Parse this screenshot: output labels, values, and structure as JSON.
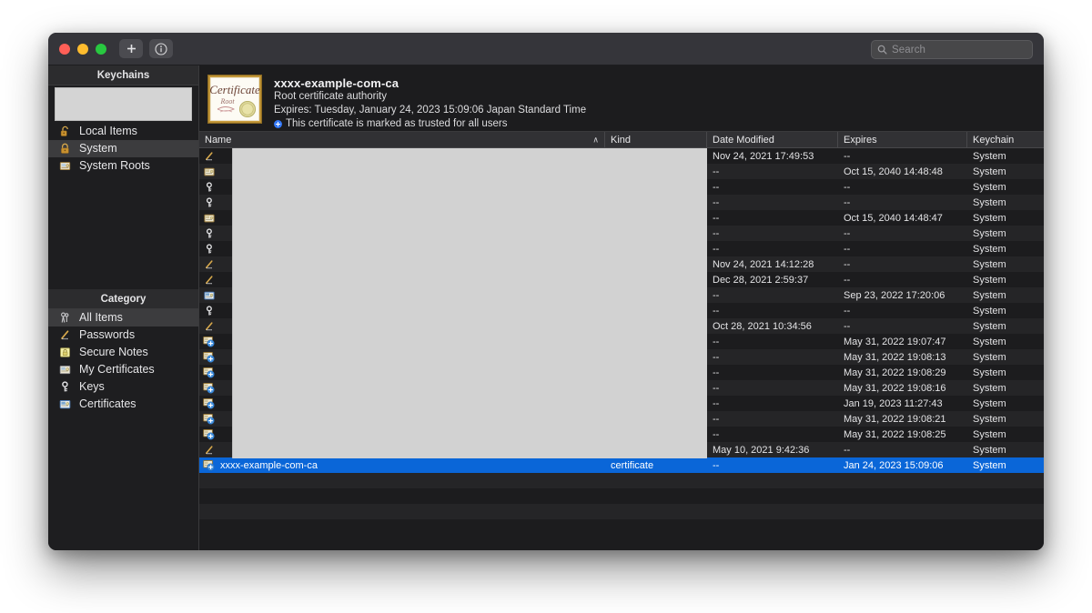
{
  "window": {
    "traffic_lights": [
      "close",
      "minimize",
      "maximize"
    ],
    "colors": {
      "close": "#ff5f57",
      "minimize": "#febc2e",
      "maximize": "#28c840",
      "selection_blue": "#0a66d8",
      "trust_blue": "#3478f6",
      "redaction_grey": "#d2d2d2"
    }
  },
  "toolbar": {
    "add_button_label": "+",
    "add_button_icon": "plus-icon",
    "info_button_icon": "info-circle-icon"
  },
  "search": {
    "placeholder": "Search",
    "value": "",
    "icon": "search-icon"
  },
  "sidebar": {
    "keychains_header": "Keychains",
    "category_header": "Category",
    "redacted_keychain_entry": "",
    "keychains": [
      {
        "label": "Local Items",
        "icon": "unlock-icon",
        "selected": false
      },
      {
        "label": "System",
        "icon": "lock-icon",
        "selected": true
      },
      {
        "label": "System Roots",
        "icon": "folder-cert-icon",
        "selected": false
      }
    ],
    "categories": [
      {
        "label": "All Items",
        "icon": "all-items-icon",
        "selected": true
      },
      {
        "label": "Passwords",
        "icon": "password-icon",
        "selected": false
      },
      {
        "label": "Secure Notes",
        "icon": "secure-note-icon",
        "selected": false
      },
      {
        "label": "My Certificates",
        "icon": "my-certificate-icon",
        "selected": false
      },
      {
        "label": "Keys",
        "icon": "key-icon",
        "selected": false
      },
      {
        "label": "Certificates",
        "icon": "certificate-icon",
        "selected": false
      }
    ]
  },
  "certificate_banner": {
    "thumbnail_icon": "certificate-root-icon",
    "thumbnail_text_main": "Certificate",
    "thumbnail_text_sub": "Root",
    "title": "xxxx-example-com-ca",
    "subtitle": "Root certificate authority",
    "expires": "Expires: Tuesday, January 24, 2023 15:09:06 Japan Standard Time",
    "trust_status": "This certificate is marked as trusted for all users",
    "trust_icon": "trusted-plus-icon"
  },
  "table": {
    "columns": [
      {
        "key": "name",
        "label": "Name",
        "sorted": "asc"
      },
      {
        "key": "kind",
        "label": "Kind",
        "sorted": ""
      },
      {
        "key": "modified",
        "label": "Date Modified",
        "sorted": ""
      },
      {
        "key": "expires",
        "label": "Expires",
        "sorted": ""
      },
      {
        "key": "keychain",
        "label": "Keychain",
        "sorted": ""
      }
    ],
    "sort_caret": "∧",
    "redacted_region": true,
    "rows": [
      {
        "icon": "password-icon",
        "name": "",
        "kind": "",
        "modified": "Nov 24, 2021 17:49:53",
        "expires": "--",
        "keychain": "System",
        "selected": false
      },
      {
        "icon": "certificate-gold-icon",
        "name": "",
        "kind": "",
        "modified": "--",
        "expires": "Oct 15, 2040 14:48:48",
        "keychain": "System",
        "selected": false
      },
      {
        "icon": "key-icon",
        "name": "",
        "kind": "",
        "modified": "--",
        "expires": "--",
        "keychain": "System",
        "selected": false
      },
      {
        "icon": "key-icon",
        "name": "",
        "kind": "",
        "modified": "--",
        "expires": "--",
        "keychain": "System",
        "selected": false
      },
      {
        "icon": "certificate-gold-icon",
        "name": "",
        "kind": "",
        "modified": "--",
        "expires": "Oct 15, 2040 14:48:47",
        "keychain": "System",
        "selected": false
      },
      {
        "icon": "key-icon",
        "name": "",
        "kind": "",
        "modified": "--",
        "expires": "--",
        "keychain": "System",
        "selected": false
      },
      {
        "icon": "key-icon",
        "name": "",
        "kind": "",
        "modified": "--",
        "expires": "--",
        "keychain": "System",
        "selected": false
      },
      {
        "icon": "password-icon",
        "name": "",
        "kind": "",
        "modified": "Nov 24, 2021 14:12:28",
        "expires": "--",
        "keychain": "System",
        "selected": false
      },
      {
        "icon": "password-icon",
        "name": "",
        "kind": "",
        "modified": "Dec 28, 2021 2:59:37",
        "expires": "--",
        "keychain": "System",
        "selected": false
      },
      {
        "icon": "certificate-blue-icon",
        "name": "",
        "kind": "",
        "modified": "--",
        "expires": "Sep 23, 2022 17:20:06",
        "keychain": "System",
        "selected": false
      },
      {
        "icon": "key-icon",
        "name": "",
        "kind": "",
        "modified": "--",
        "expires": "--",
        "keychain": "System",
        "selected": false
      },
      {
        "icon": "password-icon",
        "name": "",
        "kind": "",
        "modified": "Oct 28, 2021 10:34:56",
        "expires": "--",
        "keychain": "System",
        "selected": false
      },
      {
        "icon": "root-certificate-icon",
        "name": "",
        "kind": "",
        "modified": "--",
        "expires": "May 31, 2022 19:07:47",
        "keychain": "System",
        "selected": false
      },
      {
        "icon": "root-certificate-icon",
        "name": "",
        "kind": "",
        "modified": "--",
        "expires": "May 31, 2022 19:08:13",
        "keychain": "System",
        "selected": false
      },
      {
        "icon": "root-certificate-icon",
        "name": "",
        "kind": "",
        "modified": "--",
        "expires": "May 31, 2022 19:08:29",
        "keychain": "System",
        "selected": false
      },
      {
        "icon": "root-certificate-icon",
        "name": "",
        "kind": "",
        "modified": "--",
        "expires": "May 31, 2022 19:08:16",
        "keychain": "System",
        "selected": false
      },
      {
        "icon": "root-certificate-icon",
        "name": "",
        "kind": "",
        "modified": "--",
        "expires": "Jan 19, 2023 11:27:43",
        "keychain": "System",
        "selected": false
      },
      {
        "icon": "root-certificate-icon",
        "name": "",
        "kind": "",
        "modified": "--",
        "expires": "May 31, 2022 19:08:21",
        "keychain": "System",
        "selected": false
      },
      {
        "icon": "root-certificate-icon",
        "name": "",
        "kind": "",
        "modified": "--",
        "expires": "May 31, 2022 19:08:25",
        "keychain": "System",
        "selected": false
      },
      {
        "icon": "password-icon",
        "name": "",
        "kind": "",
        "modified": "May 10, 2021 9:42:36",
        "expires": "--",
        "keychain": "System",
        "selected": false
      },
      {
        "icon": "root-certificate-icon",
        "name": "xxxx-example-com-ca",
        "kind": "certificate",
        "modified": "--",
        "expires": "Jan 24, 2023 15:09:06",
        "keychain": "System",
        "selected": true
      },
      {
        "icon": "",
        "name": "",
        "kind": "",
        "modified": "",
        "expires": "",
        "keychain": "",
        "selected": false
      },
      {
        "icon": "",
        "name": "",
        "kind": "",
        "modified": "",
        "expires": "",
        "keychain": "",
        "selected": false
      },
      {
        "icon": "",
        "name": "",
        "kind": "",
        "modified": "",
        "expires": "",
        "keychain": "",
        "selected": false
      }
    ]
  }
}
